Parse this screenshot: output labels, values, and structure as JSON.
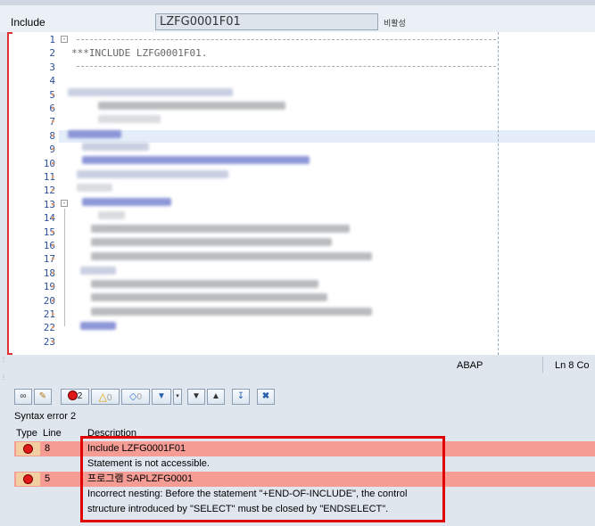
{
  "header": {
    "label": "Include",
    "include_name": "LZFG0001F01",
    "status": "비활성"
  },
  "editor": {
    "line_numbers": [
      "1",
      "2",
      "3",
      "4",
      "5",
      "6",
      "7",
      "8",
      "9",
      "10",
      "11",
      "12",
      "13",
      "14",
      "15",
      "16",
      "17",
      "18",
      "19",
      "20",
      "21",
      "22",
      "23"
    ],
    "code_line_2": "***INCLUDE LZFG0001F01."
  },
  "statusbar": {
    "language": "ABAP",
    "position": "Ln  8 Co"
  },
  "panel": {
    "toolbar": {
      "error_count": "2",
      "warning_count": "0",
      "info_count": "0"
    },
    "title": "Syntax error 2",
    "columns": {
      "type": "Type",
      "line": "Line",
      "description": "Description"
    },
    "rows": [
      {
        "line": "8",
        "title": "Include LZFG0001F01",
        "detail": [
          "Statement is not accessible."
        ]
      },
      {
        "line": "5",
        "title": "프로그램 SAPLZFG0001",
        "detail": [
          "Incorrect nesting: Before the statement \"+END-OF-INCLUDE\", the control",
          "structure introduced by \"SELECT\" must be closed by \"ENDSELECT\"."
        ]
      }
    ]
  },
  "colors": {
    "error_row": "#f59c94",
    "highlight_box": "#e00000",
    "line_number": "#2b4f9a"
  }
}
